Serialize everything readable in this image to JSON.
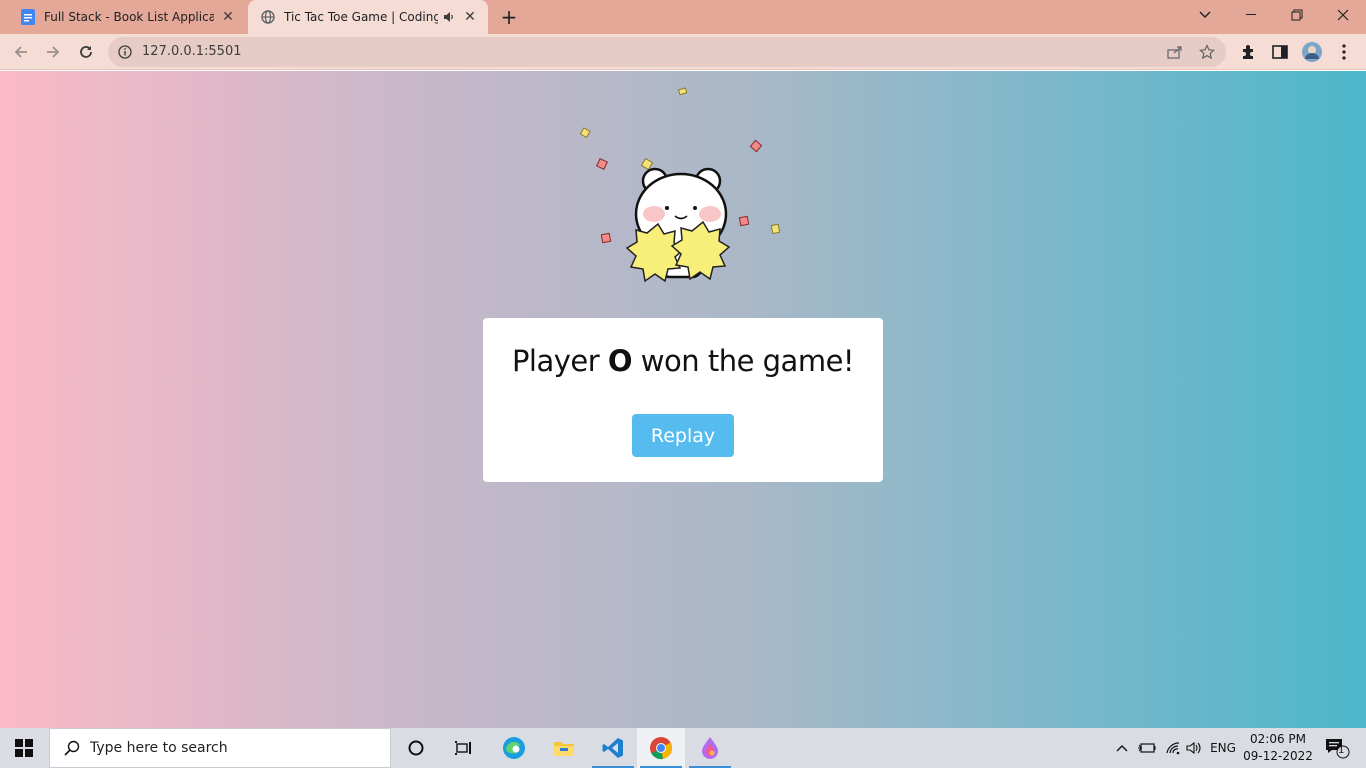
{
  "browser": {
    "tabs": [
      {
        "title": "Full Stack - Book List Application",
        "icon": "google-docs-icon",
        "active": false
      },
      {
        "title": "Tic Tac Toe Game | CodingNepal",
        "icon": "globe-icon",
        "active": true,
        "audio": true
      }
    ],
    "url": "127.0.0.1:5501"
  },
  "page": {
    "result": {
      "prefix": "Player",
      "winner": "O",
      "suffix": "won the game!"
    },
    "replay_label": "Replay"
  },
  "taskbar": {
    "search_placeholder": "Type here to search",
    "language": "ENG",
    "time": "02:06 PM",
    "date": "09-12-2022",
    "notification_count": "1",
    "apps": [
      "cortana-icon",
      "task-view-icon",
      "edge-icon",
      "file-explorer-icon",
      "vscode-icon",
      "chrome-icon",
      "paint-3d-icon"
    ]
  },
  "colors": {
    "gradient_start": "#fbb9c7",
    "gradient_end": "#4db7cb",
    "replay_button": "#56bbee",
    "tabstrip": "#e4a898"
  }
}
